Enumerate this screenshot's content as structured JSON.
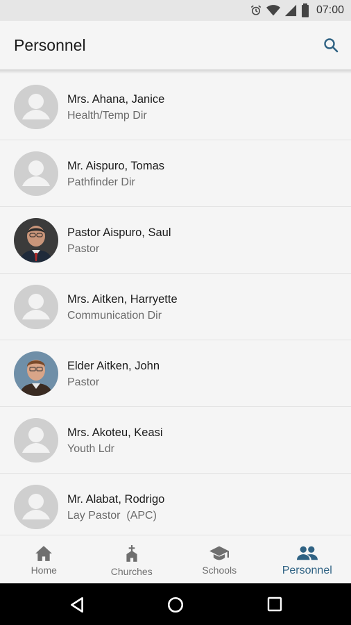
{
  "status": {
    "time": "07:00"
  },
  "appbar": {
    "title": "Personnel"
  },
  "people": [
    {
      "name": "Mrs. Ahana, Janice",
      "role": "Health/Temp Dir",
      "photo": "generic"
    },
    {
      "name": "Mr. Aispuro, Tomas",
      "role": "Pathfinder Dir",
      "photo": "generic"
    },
    {
      "name": "Pastor Aispuro, Saul",
      "role": "Pastor",
      "photo": "photo"
    },
    {
      "name": "Mrs. Aitken, Harryette",
      "role": "Communication Dir",
      "photo": "generic"
    },
    {
      "name": "Elder Aitken, John",
      "role": "Pastor",
      "photo": "photo"
    },
    {
      "name": "Mrs. Akoteu, Keasi",
      "role": "Youth Ldr",
      "photo": "generic"
    },
    {
      "name": "Mr. Alabat, Rodrigo",
      "role": "Lay Pastor  (APC)",
      "photo": "generic"
    }
  ],
  "nav": {
    "home": "Home",
    "churches": "Churches",
    "schools": "Schools",
    "personnel": "Personnel",
    "active": "personnel"
  },
  "colors": {
    "accent": "#2f6283",
    "inactive": "#6f6f6f"
  }
}
